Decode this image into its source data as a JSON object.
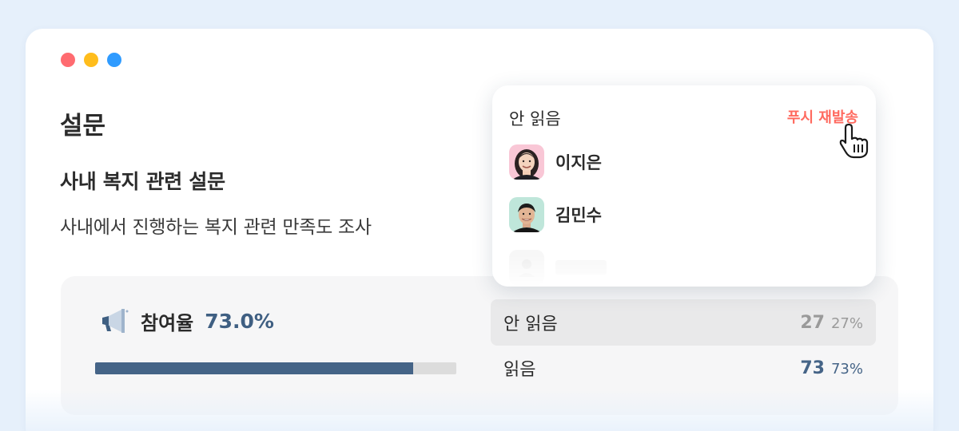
{
  "window": {
    "traffic_lights": [
      "red",
      "yellow",
      "blue"
    ]
  },
  "page": {
    "title": "설문"
  },
  "survey": {
    "title": "사내 복지 관련 설문",
    "description": "사내에서 진행하는 복지 관련 만족도 조사"
  },
  "participation": {
    "icon": "megaphone-icon",
    "label": "참여율",
    "value_text": "73.0%",
    "progress_fraction": 0.88
  },
  "stats": {
    "unread": {
      "label": "안 읽음",
      "count": "27",
      "percent": "27%"
    },
    "read": {
      "label": "읽음",
      "count": "73",
      "percent": "73%"
    }
  },
  "popup": {
    "title": "안 읽음",
    "action_label": "푸시 재발송",
    "users": [
      {
        "name": "이지은",
        "avatar_bg": "#f9c7d6"
      },
      {
        "name": "김민수",
        "avatar_bg": "#bfe6da"
      }
    ]
  },
  "colors": {
    "accent_blue": "#456487",
    "resend_red": "#ff6a5f",
    "background": "#e6f0fb"
  }
}
